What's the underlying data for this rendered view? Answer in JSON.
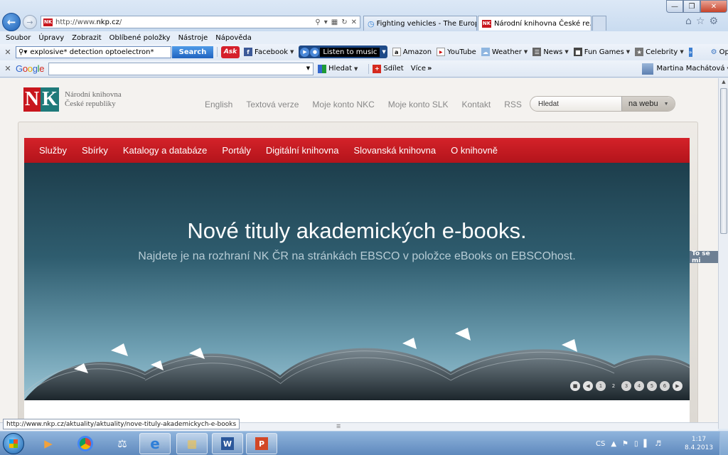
{
  "browser": {
    "address": {
      "prefix": "http://www.",
      "domain": "nkp.cz",
      "suffix": "/"
    },
    "tabs": [
      {
        "label": "Fighting vehicles - The Europe...",
        "active": false
      },
      {
        "label": "Národní knihovna České re...",
        "active": true
      }
    ],
    "menu": [
      "Soubor",
      "Úpravy",
      "Zobrazit",
      "Oblíbené položky",
      "Nástroje",
      "Nápověda"
    ],
    "ask_toolbar": {
      "search_value": "explosive* detection optoelectron*",
      "search_button": "Search",
      "ask_logo": "Ask",
      "items": [
        "Facebook",
        "Amazon",
        "YouTube",
        "Weather",
        "News",
        "Fun Games",
        "Celebrity"
      ],
      "music_label": "Listen to music",
      "options_label": "Options"
    },
    "google_toolbar": {
      "logo": "Google",
      "search_label": "Hledat",
      "share_label": "Sdílet",
      "more_label": "Více",
      "user_name": "Martina Machátová"
    },
    "status_url": "http://www.nkp.cz/aktuality/aktuality/nove-tituly-akademickych-e-books"
  },
  "site": {
    "logo_name_line1": "Národní knihovna",
    "logo_name_line2": "České republiky",
    "top_links": [
      "English",
      "Textová verze",
      "Moje konto NKC",
      "Moje konto SLK",
      "Kontakt",
      "RSS"
    ],
    "search_placeholder": "Hledat",
    "search_scope": "na webu",
    "main_nav": [
      "Služby",
      "Sbírky",
      "Katalogy a databáze",
      "Portály",
      "Digitální knihovna",
      "Slovanská knihovna",
      "O knihovně"
    ],
    "side_tab": "To se mi",
    "hero": {
      "title": "Nové tituly akademických e-books.",
      "subtitle": "Najdete je na rozhraní NK ČR na stránkách EBSCO v položce eBooks on EBSCOhost."
    },
    "slider_pages": [
      "1",
      "2",
      "3",
      "4",
      "5",
      "6"
    ],
    "slider_active": "2"
  },
  "taskbar": {
    "language": "CS",
    "time": "1:17",
    "date": "8.4.2013"
  },
  "colors": {
    "nav_red": "#c8161d",
    "logo_teal": "#1f7a7a",
    "hero_dark": "#1d3e4c"
  }
}
